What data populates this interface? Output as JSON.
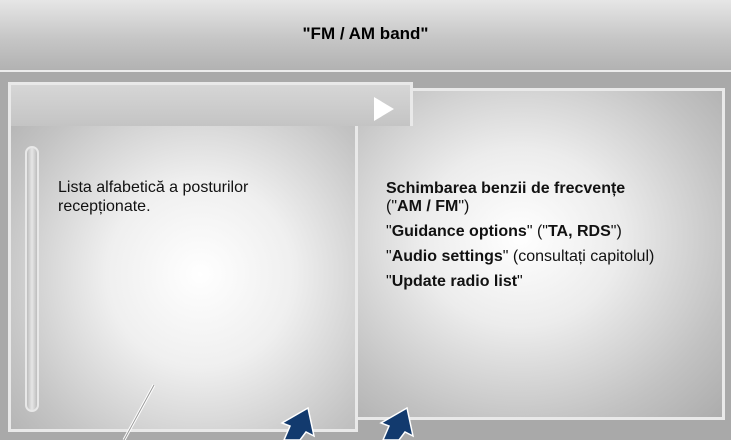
{
  "header": {
    "title": "\"FM / AM band\""
  },
  "list_panel": {
    "description": "Lista alfabetică a posturilor recepționate."
  },
  "menu_panel": {
    "items": [
      {
        "bold": "Schimbarea benzii de frecvențe",
        "pre2": "(\"",
        "bold2": "AM / FM",
        "post2": "\")"
      },
      {
        "pre": "\"",
        "bold": "Guidance options",
        "mid": "\" (\"",
        "bold2": "TA, RDS",
        "post": "\")"
      },
      {
        "pre": "\"",
        "bold": "Audio settings",
        "post": "\" (consultați capitolul)"
      },
      {
        "pre": "\"",
        "bold": "Update radio list",
        "post": "\""
      }
    ]
  },
  "icons": {
    "play": "play-arrow-icon",
    "callout_line": "callout-line",
    "arrow_left": "up-arrow-icon",
    "arrow_right": "up-arrow-icon"
  },
  "colors": {
    "background": "#a9a9a9",
    "panel_border": "#e9e9e9",
    "arrow": "#123a6e"
  }
}
